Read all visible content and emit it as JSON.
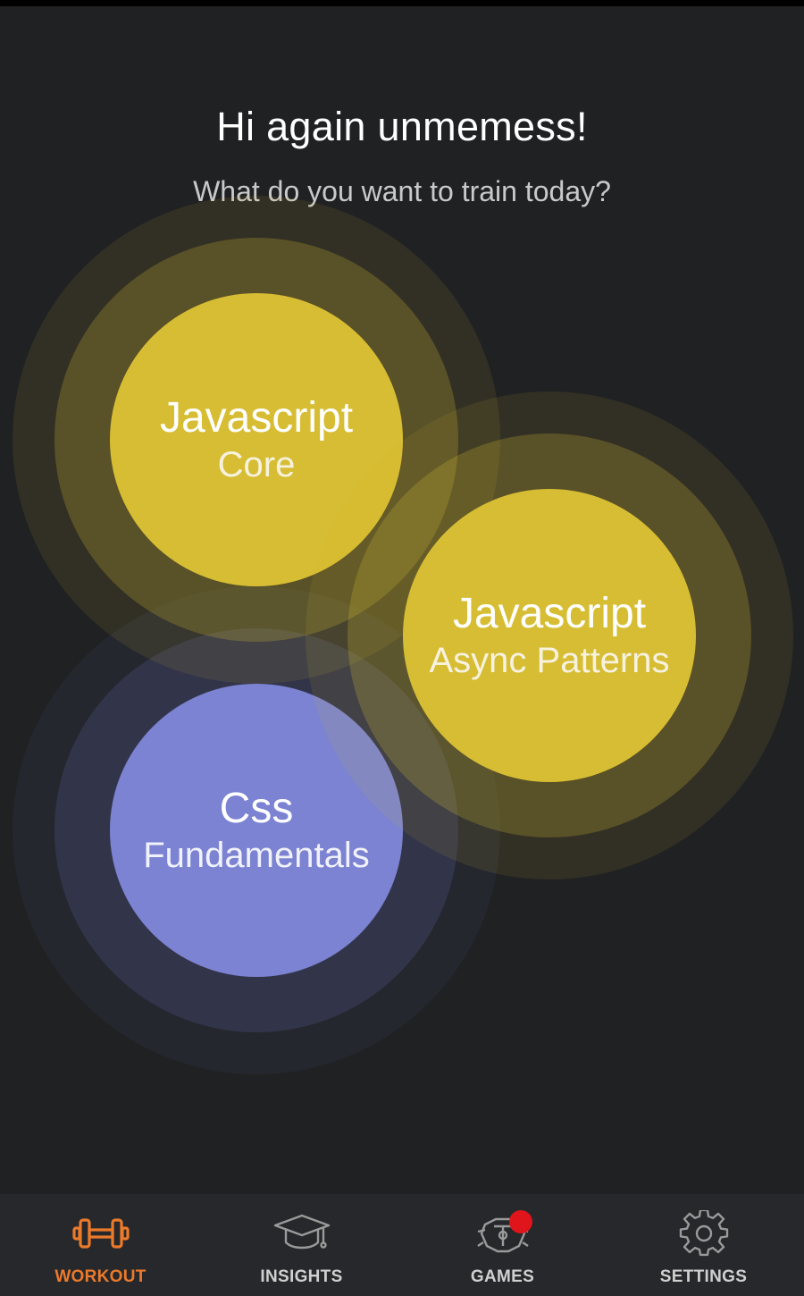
{
  "greeting": "Hi again unmemess!",
  "subtitle": "What do you want to train today?",
  "topics": [
    {
      "title": "Javascript",
      "subtitle": "Core",
      "color": "#d7bd33"
    },
    {
      "title": "Javascript",
      "subtitle": "Async Patterns",
      "color": "#d7bd33"
    },
    {
      "title": "Css",
      "subtitle": "Fundamentals",
      "color": "#7b83d2"
    }
  ],
  "nav": {
    "active_color": "#ec7a2b",
    "items": [
      {
        "label": "WORKOUT",
        "icon": "dumbbell-icon",
        "active": true
      },
      {
        "label": "INSIGHTS",
        "icon": "graduation-cap-icon",
        "active": false
      },
      {
        "label": "GAMES",
        "icon": "games-icon",
        "active": false,
        "badge_color": "#e0151c"
      },
      {
        "label": "SETTINGS",
        "icon": "gear-icon",
        "active": false
      }
    ]
  }
}
